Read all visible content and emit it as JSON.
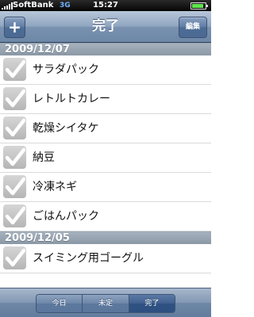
{
  "status_bar": {
    "carrier": "SoftBank",
    "network": "3G",
    "time": "15:27"
  },
  "nav": {
    "title": "完了",
    "add_label": "+",
    "edit_label": "編集"
  },
  "sections": [
    {
      "date": "2009/12/07",
      "items": [
        {
          "label": "サラダパック",
          "checked": true
        },
        {
          "label": "レトルトカレー",
          "checked": true
        },
        {
          "label": "乾燥シイタケ",
          "checked": true
        },
        {
          "label": "納豆",
          "checked": true
        },
        {
          "label": "冷凍ネギ",
          "checked": true
        },
        {
          "label": "ごはんパック",
          "checked": true
        }
      ]
    },
    {
      "date": "2009/12/05",
      "items": [
        {
          "label": "スイミング用ゴーグル",
          "checked": true
        }
      ]
    }
  ],
  "toolbar": {
    "segments": [
      "今日",
      "未定",
      "完了"
    ],
    "selected": "完了"
  }
}
